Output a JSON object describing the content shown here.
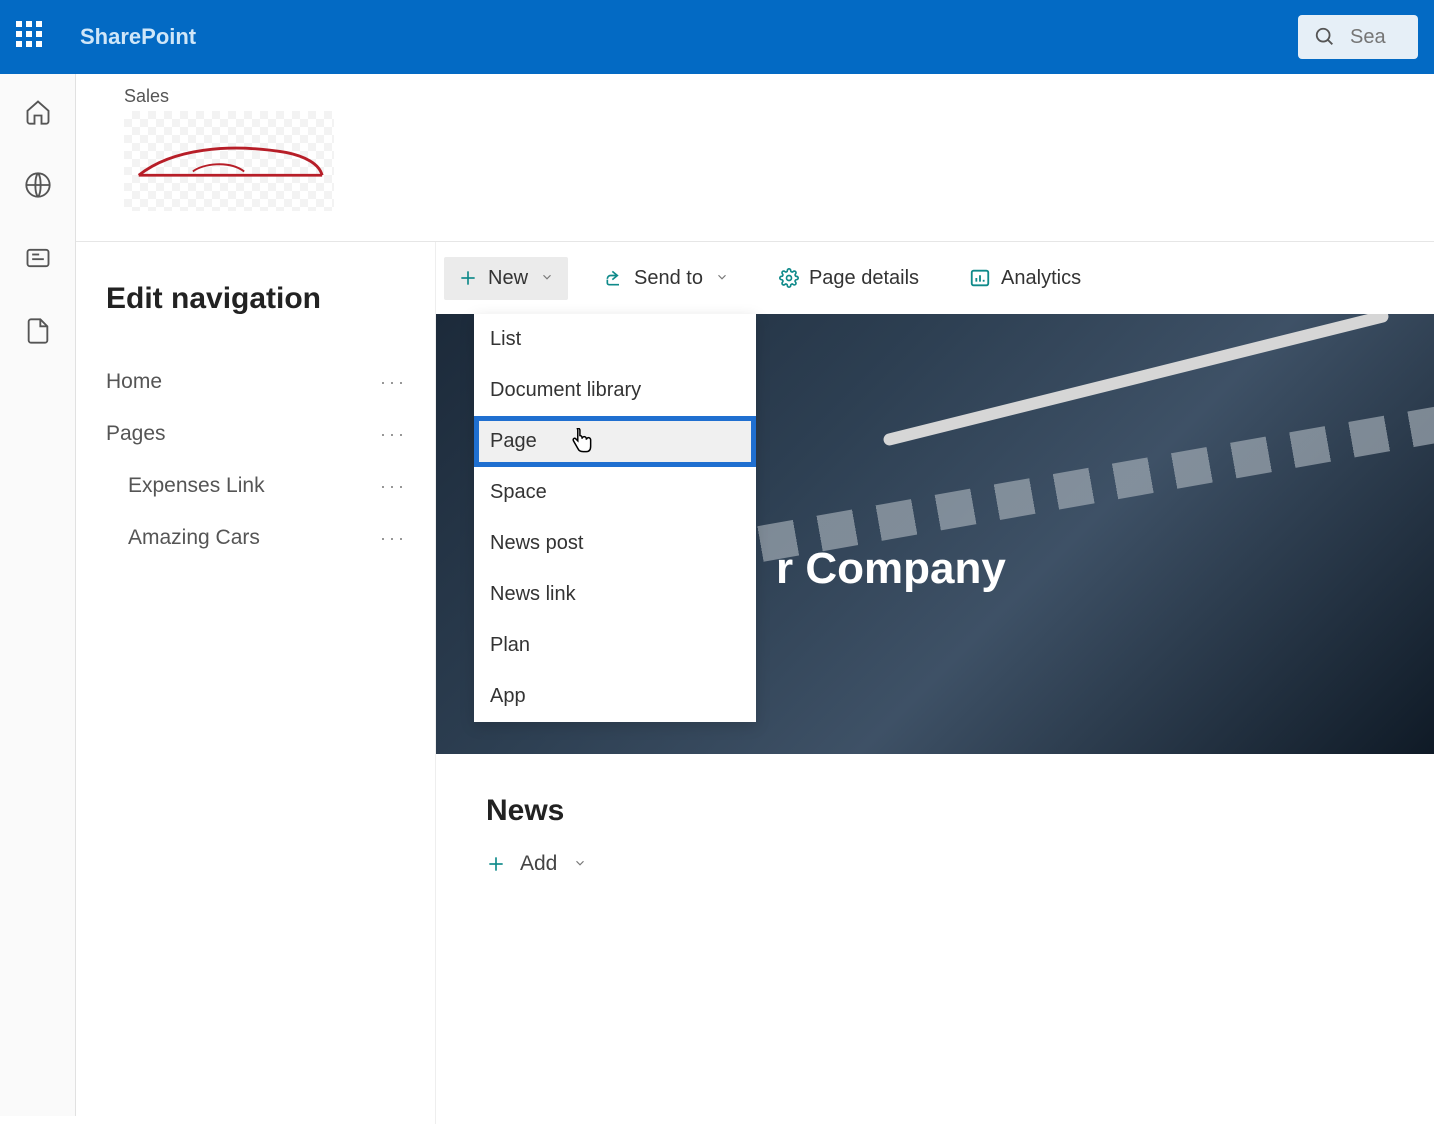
{
  "suite": {
    "app_name": "SharePoint",
    "search_placeholder": "Sea"
  },
  "site": {
    "label": "Sales"
  },
  "edit_nav": {
    "title": "Edit navigation",
    "items": [
      {
        "label": "Home",
        "child": false
      },
      {
        "label": "Pages",
        "child": false
      },
      {
        "label": "Expenses Link",
        "child": true
      },
      {
        "label": "Amazing Cars",
        "child": true
      }
    ]
  },
  "toolbar": {
    "new_label": "New",
    "send_to_label": "Send to",
    "page_details_label": "Page details",
    "analytics_label": "Analytics"
  },
  "new_menu": {
    "items": [
      {
        "label": "List",
        "highlight": false
      },
      {
        "label": "Document library",
        "highlight": false
      },
      {
        "label": "Page",
        "highlight": true
      },
      {
        "label": "Space",
        "highlight": false
      },
      {
        "label": "News post",
        "highlight": false
      },
      {
        "label": "News link",
        "highlight": false
      },
      {
        "label": "Plan",
        "highlight": false
      },
      {
        "label": "App",
        "highlight": false
      }
    ]
  },
  "hero": {
    "title": "r Company"
  },
  "news": {
    "heading": "News",
    "add_label": "Add"
  }
}
